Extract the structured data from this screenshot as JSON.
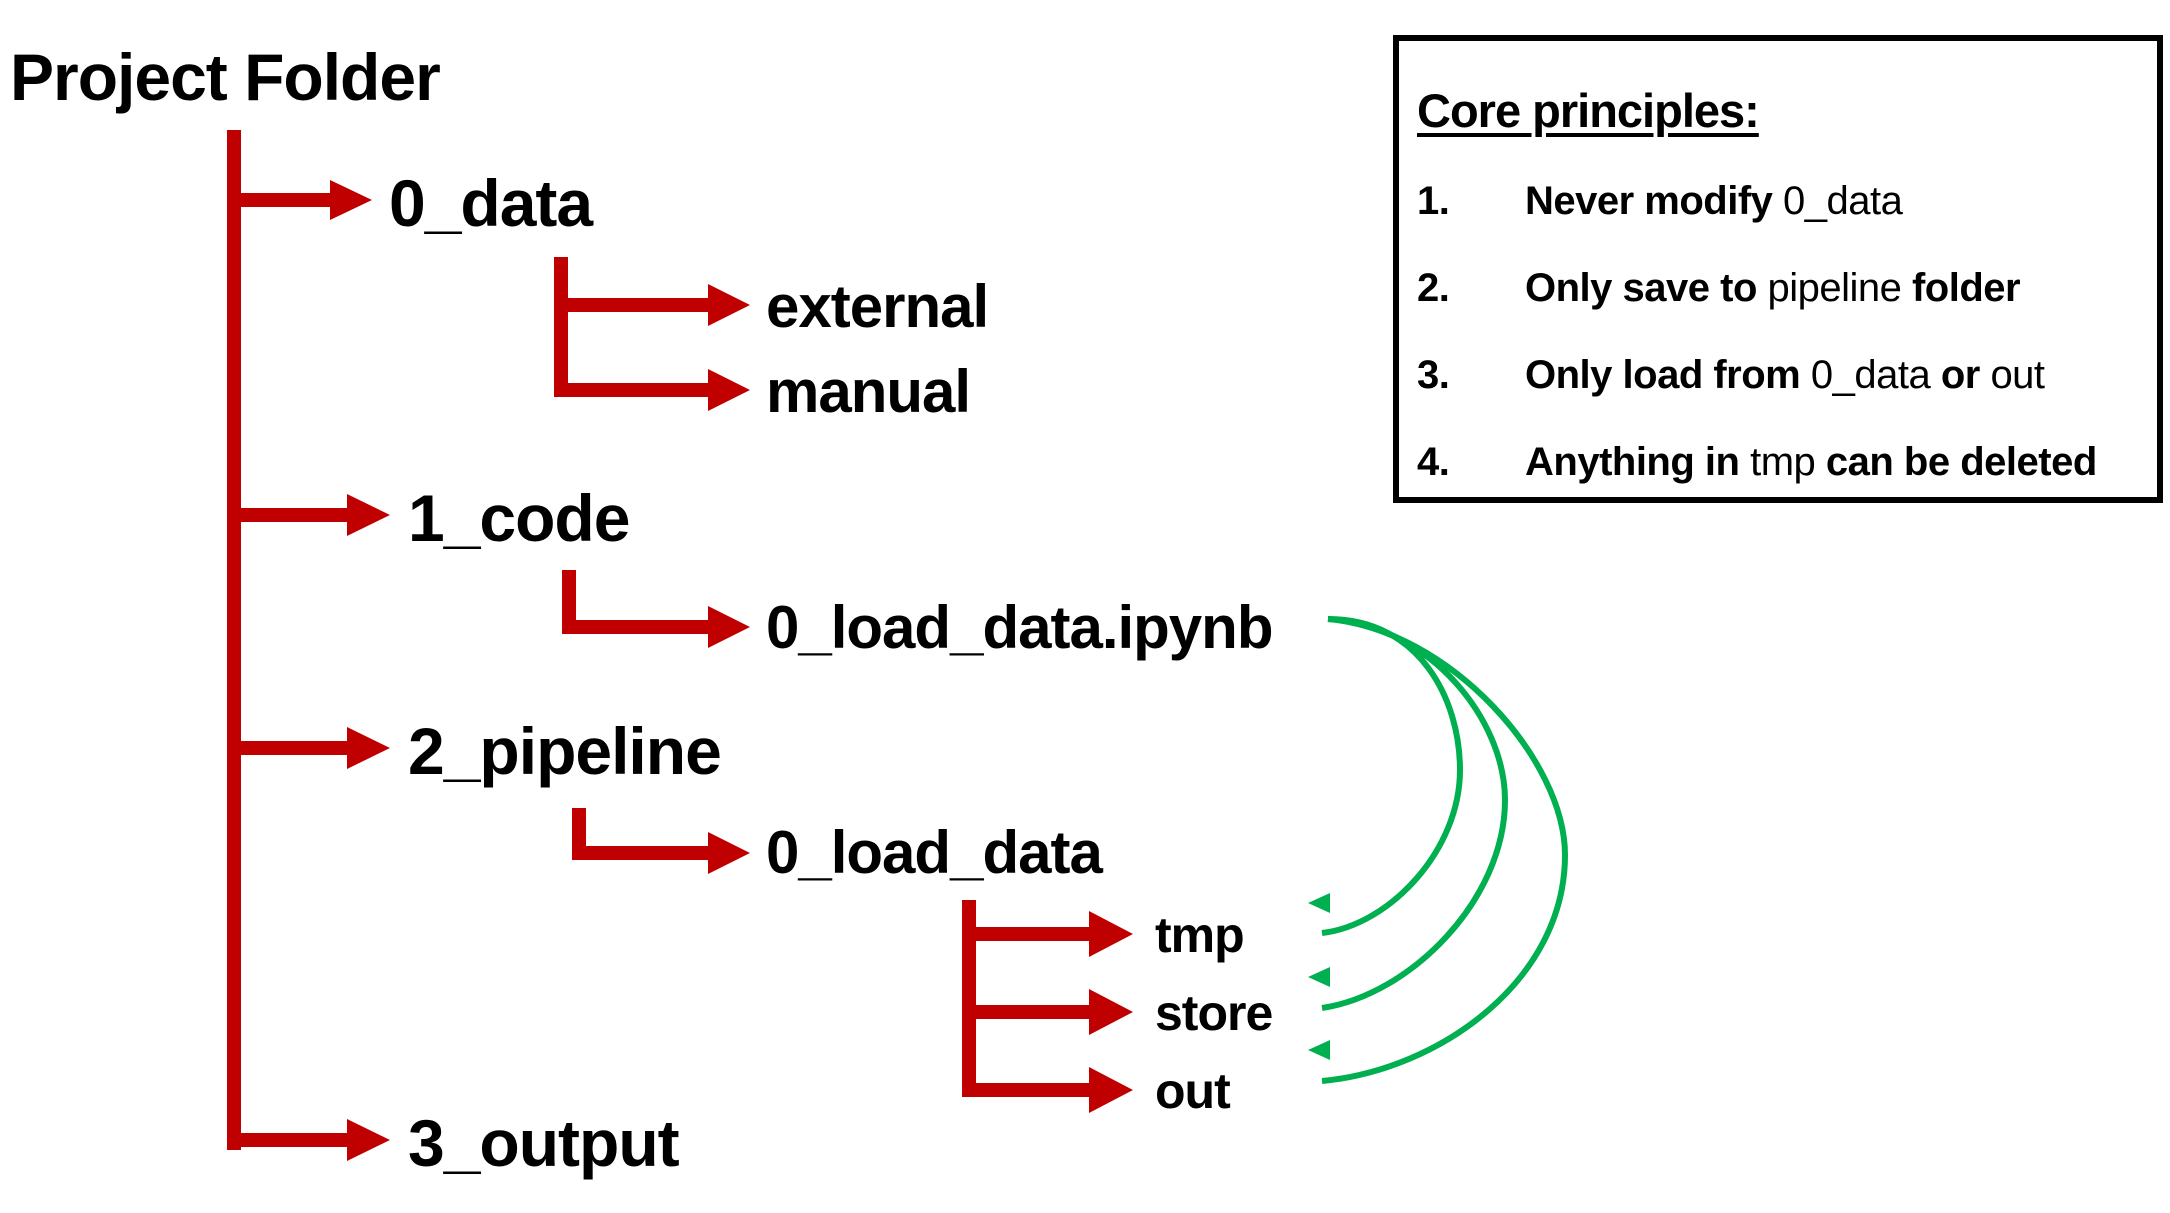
{
  "colors": {
    "tree": "#C00000",
    "flow": "#00B050",
    "text": "#000000",
    "box_border": "#000000"
  },
  "tree": {
    "root": "Project Folder",
    "folders": [
      {
        "label": "0_data",
        "children": [
          "external",
          "manual"
        ]
      },
      {
        "label": "1_code",
        "children": [
          "0_load_data.ipynb"
        ]
      },
      {
        "label": "2_pipeline",
        "children": [
          "0_load_data"
        ],
        "grandchildren": [
          "tmp",
          "store",
          "out"
        ]
      },
      {
        "label": "3_output",
        "children": []
      }
    ]
  },
  "flow_arrows": {
    "from": "0_load_data.ipynb",
    "to": [
      "tmp",
      "store",
      "out"
    ]
  },
  "principles": {
    "title": "Core principles:",
    "items": [
      {
        "num": "1.",
        "parts": [
          {
            "t": "Never modify ",
            "bold": true
          },
          {
            "t": "0_data",
            "bold": false
          }
        ]
      },
      {
        "num": "2.",
        "parts": [
          {
            "t": "Only save to ",
            "bold": true
          },
          {
            "t": "pipeline",
            "bold": false
          },
          {
            "t": " folder",
            "bold": true
          }
        ]
      },
      {
        "num": "3.",
        "parts": [
          {
            "t": "Only load from ",
            "bold": true
          },
          {
            "t": "0_data",
            "bold": false
          },
          {
            "t": " or ",
            "bold": true
          },
          {
            "t": "out",
            "bold": false
          }
        ]
      },
      {
        "num": "4.",
        "parts": [
          {
            "t": "Anything in ",
            "bold": true
          },
          {
            "t": "tmp",
            "bold": false
          },
          {
            "t": " can be deleted",
            "bold": true
          }
        ]
      }
    ]
  }
}
